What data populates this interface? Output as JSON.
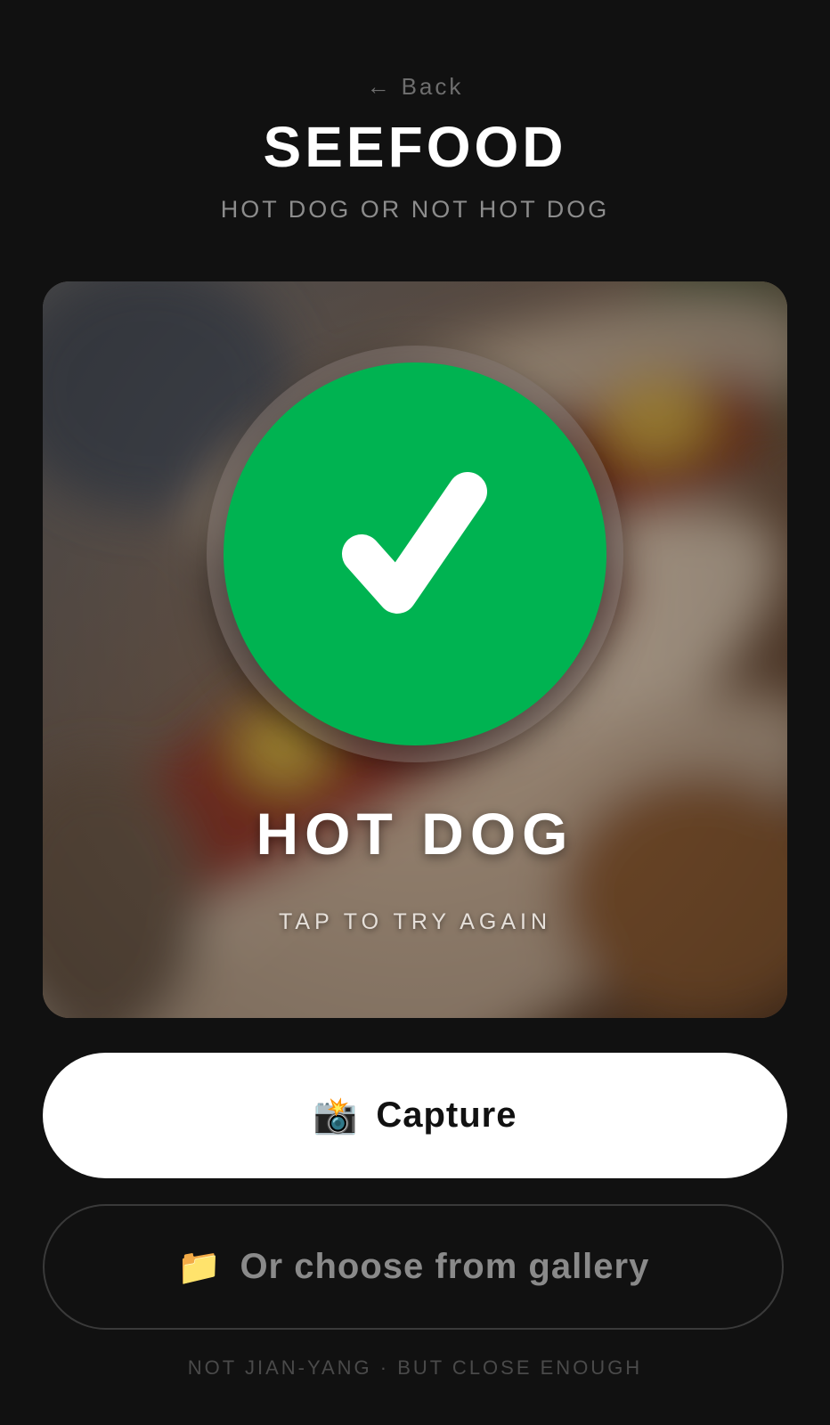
{
  "header": {
    "back_arrow": "←",
    "back_label": "Back",
    "title": "SEEFOOD",
    "subtitle": "HOT DOG OR NOT HOT DOG"
  },
  "result": {
    "verdict": "HOT DOG",
    "hint": "TAP TO TRY AGAIN",
    "icon": "checkmark-icon",
    "color": "#00b351"
  },
  "actions": {
    "capture_icon": "📸",
    "capture_label": "Capture",
    "gallery_icon": "📁",
    "gallery_label": "Or choose from gallery"
  },
  "footer": {
    "note": "NOT JIAN-YANG · BUT CLOSE ENOUGH"
  }
}
